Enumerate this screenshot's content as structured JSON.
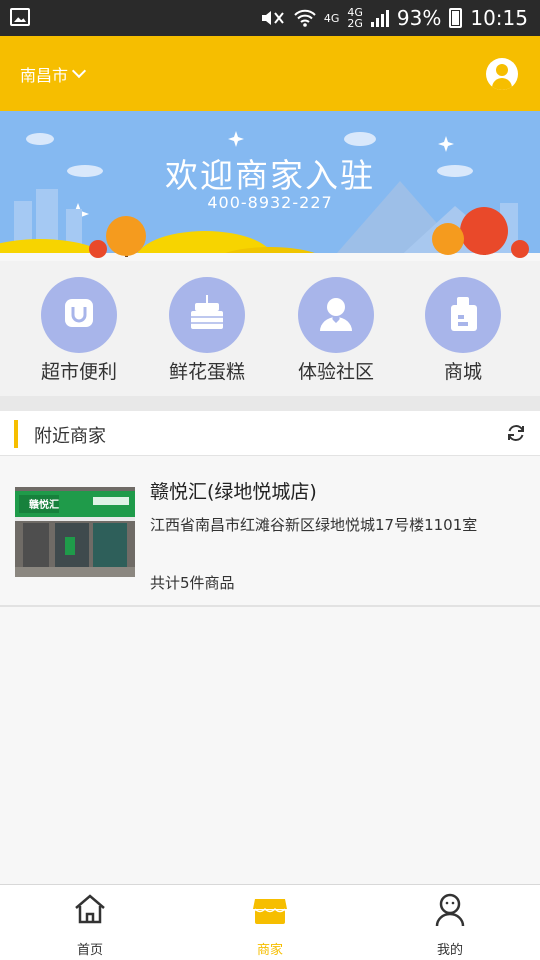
{
  "status_bar": {
    "net1": "4G",
    "net2": "4G",
    "net3": "2G",
    "battery": "93%",
    "time": "10:15"
  },
  "header": {
    "city": "南昌市"
  },
  "banner": {
    "title": "欢迎商家入驻",
    "phone": "400-8932-227"
  },
  "categories": [
    {
      "label": "超市便利",
      "icon": "shopping-bag-icon"
    },
    {
      "label": "鲜花蛋糕",
      "icon": "cake-icon"
    },
    {
      "label": "体验社区",
      "icon": "community-icon"
    },
    {
      "label": "商城",
      "icon": "mall-icon"
    }
  ],
  "nearby": {
    "title": "附近商家"
  },
  "shops": [
    {
      "name": "赣悦汇(绿地悦城店)",
      "address": "江西省南昌市红滩谷新区绿地悦城17号楼1101室",
      "count": "共计5件商品",
      "sign_text": "赣悦汇"
    }
  ],
  "bottom_nav": [
    {
      "label": "首页",
      "icon": "home-icon",
      "active": false
    },
    {
      "label": "商家",
      "icon": "shop-icon",
      "active": true
    },
    {
      "label": "我的",
      "icon": "profile-icon",
      "active": false
    }
  ],
  "colors": {
    "accent": "#f6be00",
    "banner": "#85b9f1",
    "category_circle": "#a8b5ea"
  }
}
